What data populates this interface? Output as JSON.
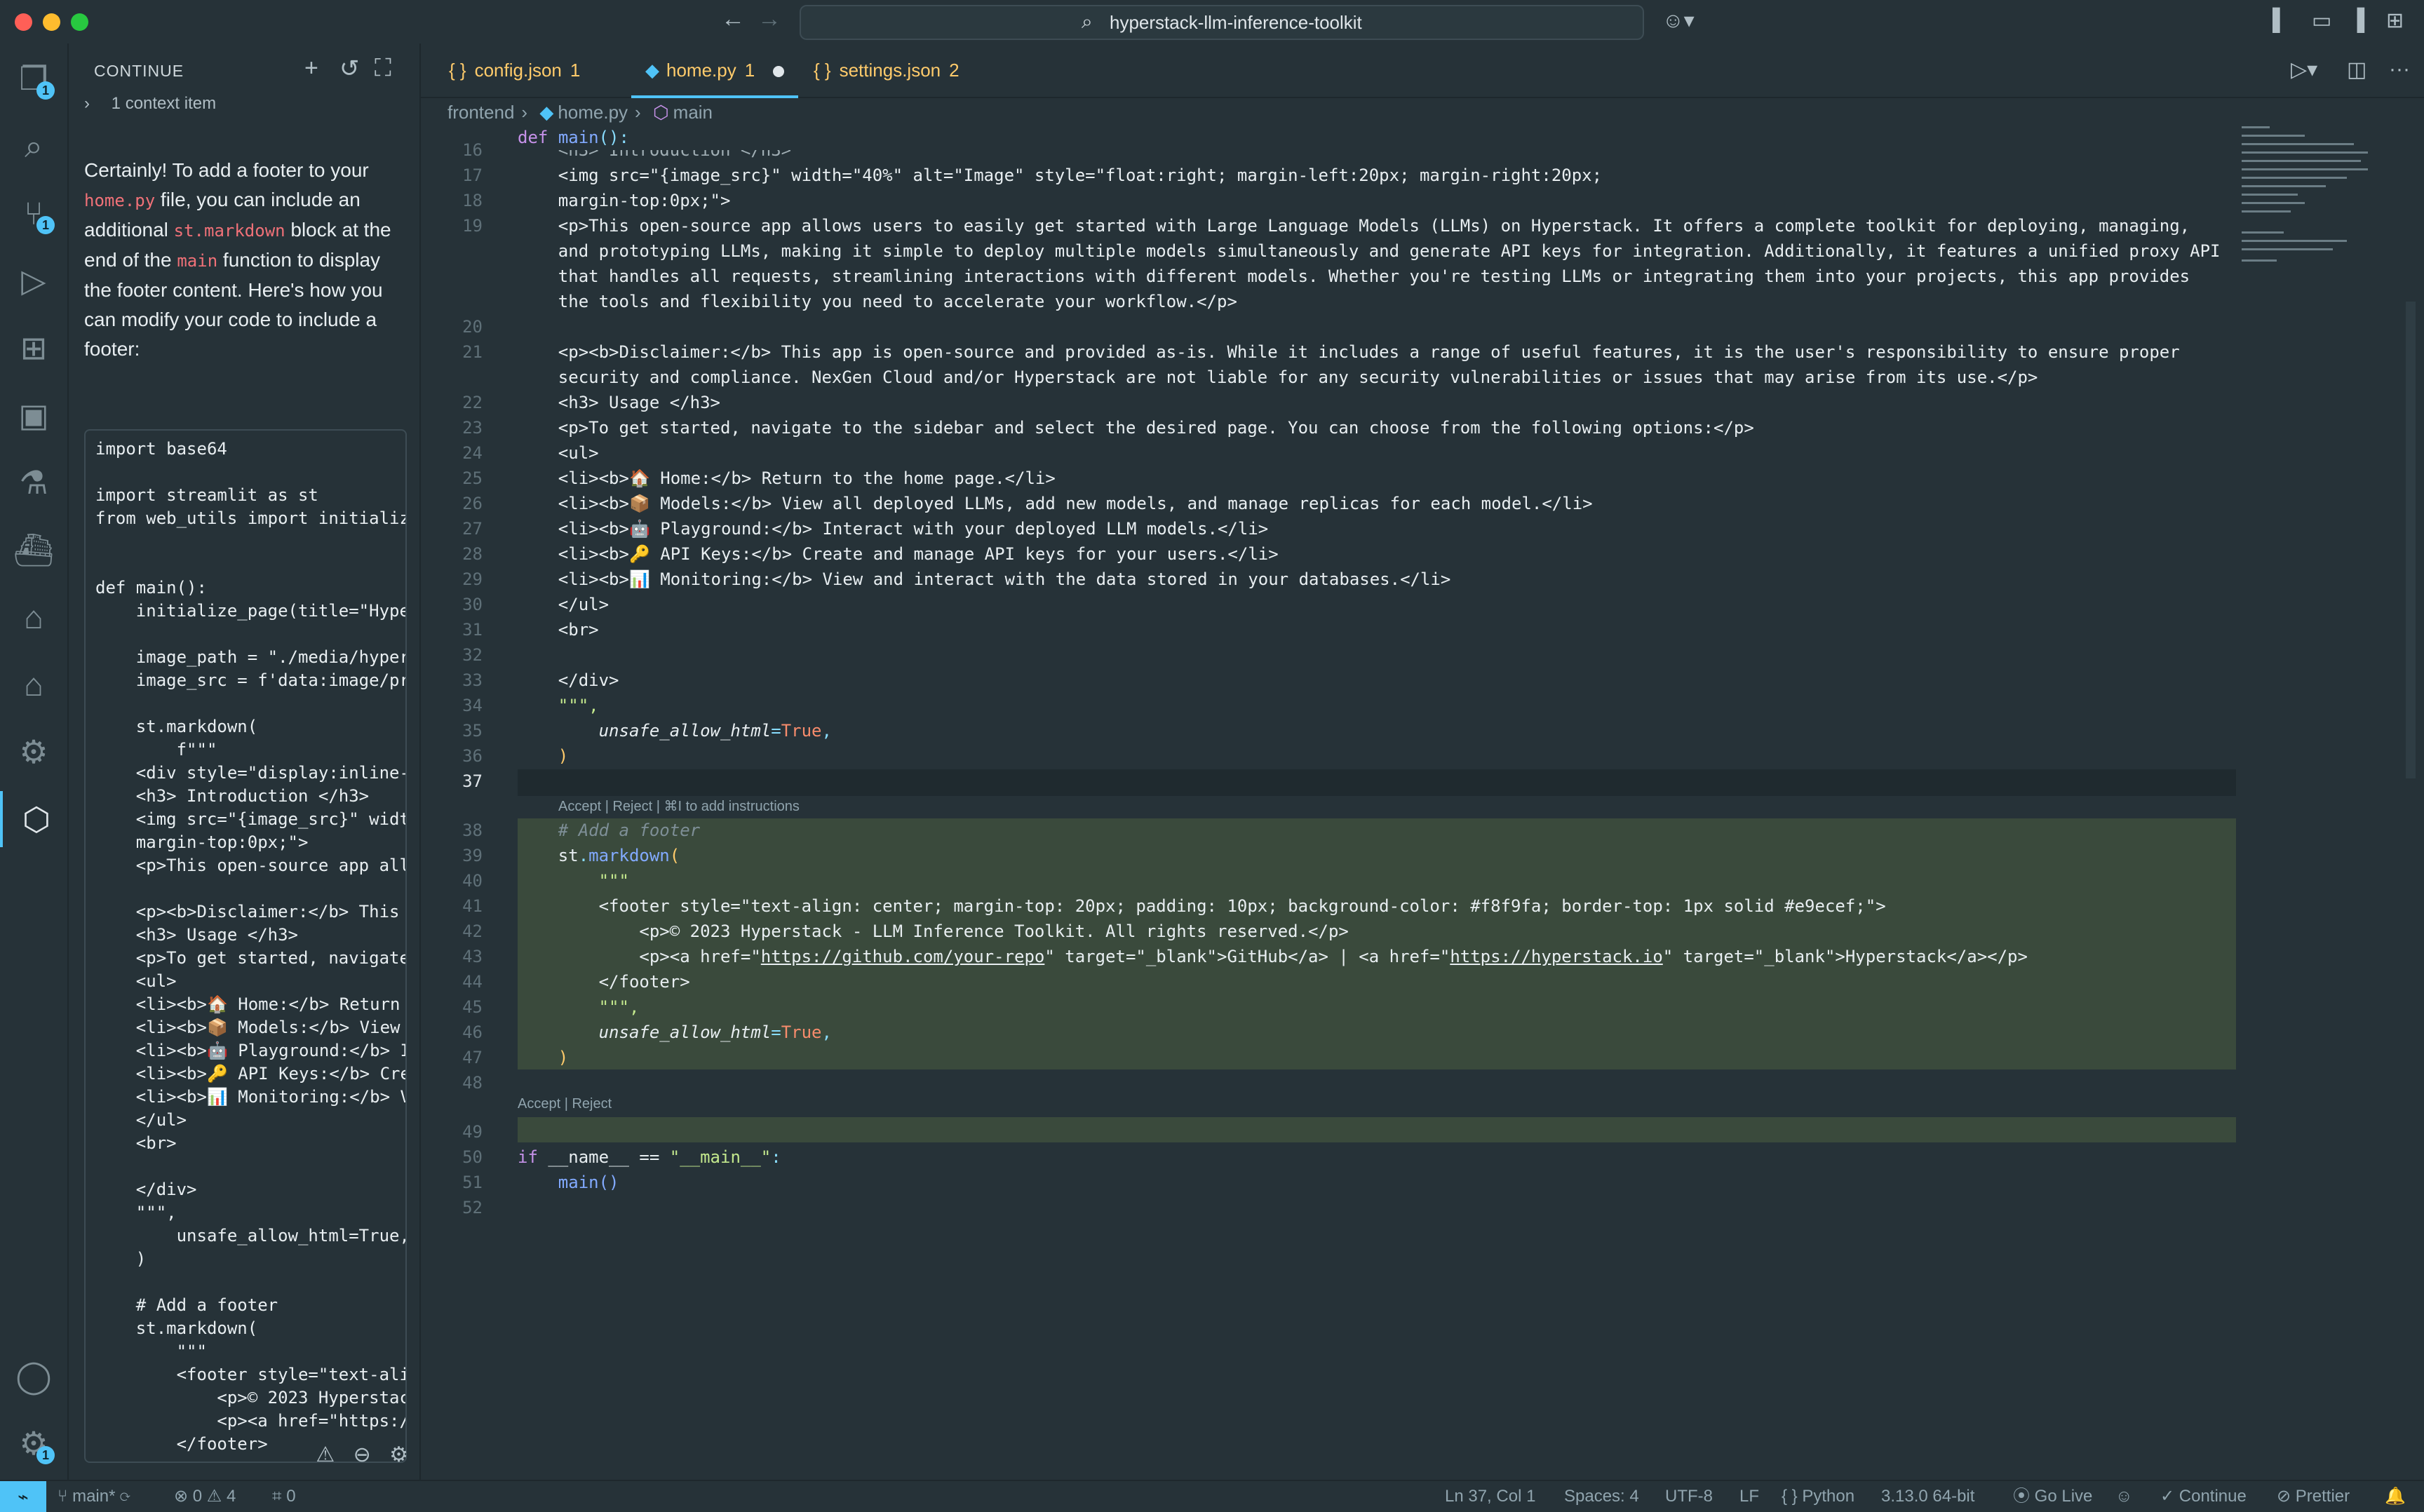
{
  "window": {
    "search_text": "hyperstack-llm-inference-toolkit"
  },
  "activity": {
    "explorer_badge": "1",
    "scm_badge": "1",
    "settings_badge": "1"
  },
  "sidebar": {
    "title": "CONTINUE",
    "context_label": "1 context item",
    "answer_parts": {
      "p1": "Certainly! To add a footer to your ",
      "c1": "home.py",
      "p2": " file, you can include an additional ",
      "c2": "st.markdown",
      "p3": " block at the end of the ",
      "c3": "main",
      "p4": " function to display the footer content. Here's how you can modify your code to include a footer:"
    },
    "snippet_lines": [
      "import base64",
      "",
      "import streamlit as st",
      "from web_utils import initializ",
      "",
      "",
      "def main():",
      "    initialize_page(title=\"Hype",
      "",
      "    image_path = \"./media/hyper",
      "    image_src = f'data:image/pr",
      "",
      "    st.markdown(",
      "        f\"\"\"",
      "    <div style=\"display:inline-",
      "    <h3> Introduction </h3>",
      "    <img src=\"{image_src}\" widt",
      "    margin-top:0px;\">",
      "    <p>This open-source app all",
      "",
      "    <p><b>Disclaimer:</b> This",
      "    <h3> Usage </h3>",
      "    <p>To get started, navigate",
      "    <ul>",
      "    <li><b>🏠 Home:</b> Return",
      "    <li><b>📦 Models:</b> View",
      "    <li><b>🤖 Playground:</b> I",
      "    <li><b>🔑 API Keys:</b> Cre",
      "    <li><b>📊 Monitoring:</b> V",
      "    </ul>",
      "    <br>",
      "",
      "    </div>",
      "    \"\"\",",
      "        unsafe_allow_html=True,",
      "    )",
      "",
      "    # Add a footer",
      "    st.markdown(",
      "        \"\"\"",
      "        <footer style=\"text-ali",
      "            <p>© 2023 Hyperstac",
      "            <p><a href=\"https:/",
      "        </footer>"
    ]
  },
  "tabs": [
    {
      "label": "config.json",
      "count": "1"
    },
    {
      "label": "home.py",
      "count": "1"
    },
    {
      "label": "settings.json",
      "count": "2"
    }
  ],
  "breadcrumb": [
    "frontend",
    "home.py",
    "main"
  ],
  "editor": {
    "sticky_line_no": "",
    "sticky": "def main():",
    "line16": "    <h3> Introduction </h3>",
    "line17": "    <img src=\"{image_src}\" width=\"40%\" alt=\"Image\" style=\"float:right; margin-left:20px; margin-right:20px;",
    "line18": "    margin-top:0px;\">",
    "line19a": "    <p>This open-source app allows users to easily get started with Large Language Models (LLMs) on Hyperstack. It offers a complete toolkit for deploying, managing,",
    "line19b": "    and prototyping LLMs, making it simple to deploy multiple models simultaneously and generate API keys for integration. Additionally, it features a unified proxy API",
    "line19c": "    that handles all requests, streamlining interactions with different models. Whether you're testing LLMs or integrating them into your projects, this app provides",
    "line19d": "    the tools and flexibility you need to accelerate your workflow.</p>",
    "line21a": "    <p><b>Disclaimer:</b> This app is open-source and provided as-is. While it includes a range of useful features, it is the user's responsibility to ensure proper",
    "line21b": "    security and compliance. NexGen Cloud and/or Hyperstack are not liable for any security vulnerabilities or issues that may arise from its use.</p>",
    "line22": "    <h3> Usage </h3>",
    "line23": "    <p>To get started, navigate to the sidebar and select the desired page. You can choose from the following options:</p>",
    "line24": "    <ul>",
    "line25": "    <li><b>🏠 Home:</b> Return to the home page.</li>",
    "line26": "    <li><b>📦 Models:</b> View all deployed LLMs, add new models, and manage replicas for each model.</li>",
    "line27": "    <li><b>🤖 Playground:</b> Interact with your deployed LLM models.</li>",
    "line28": "    <li><b>🔑 API Keys:</b> Create and manage API keys for your users.</li>",
    "line29": "    <li><b>📊 Monitoring:</b> View and interact with the data stored in your databases.</li>",
    "line30": "    </ul>",
    "line31": "    <br>",
    "line33": "    </div>",
    "line34": "    \"\"\",",
    "line35_param": "unsafe_allow_html",
    "line35_val": "True",
    "hint_top": "Accept | Reject | ⌘I to add instructions",
    "line38": "# Add a footer",
    "line39_obj": "st",
    "line39_fn": "markdown",
    "line40": "\"\"\"",
    "line41": "<footer style=\"text-align: center; margin-top: 20px; padding: 10px; background-color: #f8f9fa; border-top: 1px solid #e9ecef;\">",
    "line42": "<p>© 2023 Hyperstack - LLM Inference Toolkit. All rights reserved.</p>",
    "line43_a": "<p><a href=\"",
    "line43_url1": "https://github.com/your-repo",
    "line43_b": "\" target=\"_blank\">GitHub</a> | <a href=\"",
    "line43_url2": "https://hyperstack.io",
    "line43_c": "\" target=\"_blank\">Hyperstack</a></p>",
    "line44": "</footer>",
    "line45": "\"\"\",",
    "hint_bottom": "Accept | Reject",
    "line50_kw": "if",
    "line50_rest": " __name__ == ",
    "line50_str": "\"__main__\"",
    "line51": "main()"
  },
  "status": {
    "branch": "main*",
    "errors": "0",
    "warnings": "4",
    "ports": "0",
    "position": "Ln 37, Col 1",
    "spaces": "Spaces: 4",
    "encoding": "UTF-8",
    "eol": "LF",
    "language": "Python",
    "interpreter": "3.13.0 64-bit",
    "golive": "Go Live",
    "continue": "Continue",
    "prettier": "Prettier"
  },
  "colors": {
    "background": "#263238",
    "accent": "#4fc3f7",
    "diff_added": "#3a4a3c"
  }
}
